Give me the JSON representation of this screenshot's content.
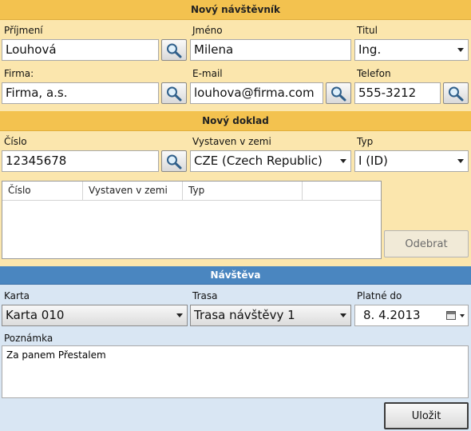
{
  "sections": {
    "visitor_title": "Nový návštěvník",
    "document_title": "Nový doklad",
    "visit_title": "Návštěva"
  },
  "visitor": {
    "surname_label": "Příjmení",
    "surname_value": "Louhová",
    "name_label": "Jméno",
    "name_value": "Milena",
    "title_label": "Titul",
    "title_value": "Ing.",
    "company_label": "Firma:",
    "company_value": "Firma, a.s.",
    "email_label": "E-mail",
    "email_value": "louhova@firma.com",
    "phone_label": "Telefon",
    "phone_value": "555-3212"
  },
  "document": {
    "number_label": "Číslo",
    "number_value": "12345678",
    "issued_label": "Vystaven v zemi",
    "issued_value": "CZE (Czech Republic)",
    "type_label": "Typ",
    "type_value": "I (ID)",
    "table": {
      "columns": [
        "Číslo",
        "Vystaven v  zemi",
        "Typ",
        ""
      ]
    },
    "remove_label": "Odebrat"
  },
  "visit": {
    "card_label": "Karta",
    "card_value": "Karta 010",
    "route_label": "Trasa",
    "route_value": "Trasa návštěvy 1",
    "valid_label": "Platné do",
    "valid_value": "8.  4.2013",
    "note_label": "Poznámka",
    "note_value": "Za panem Přestalem",
    "save_label": "Uložit"
  },
  "icons": {
    "search": "magnifier-icon",
    "calendar": "calendar-icon",
    "dropdown": "chevron-down-icon"
  },
  "colors": {
    "yellow_panel": "#fbe6ad",
    "yellow_header": "#f3c24f",
    "blue_header": "#4a86c0",
    "blue_panel": "#d9e6f3",
    "disabled_text": "#6b6b6b"
  }
}
